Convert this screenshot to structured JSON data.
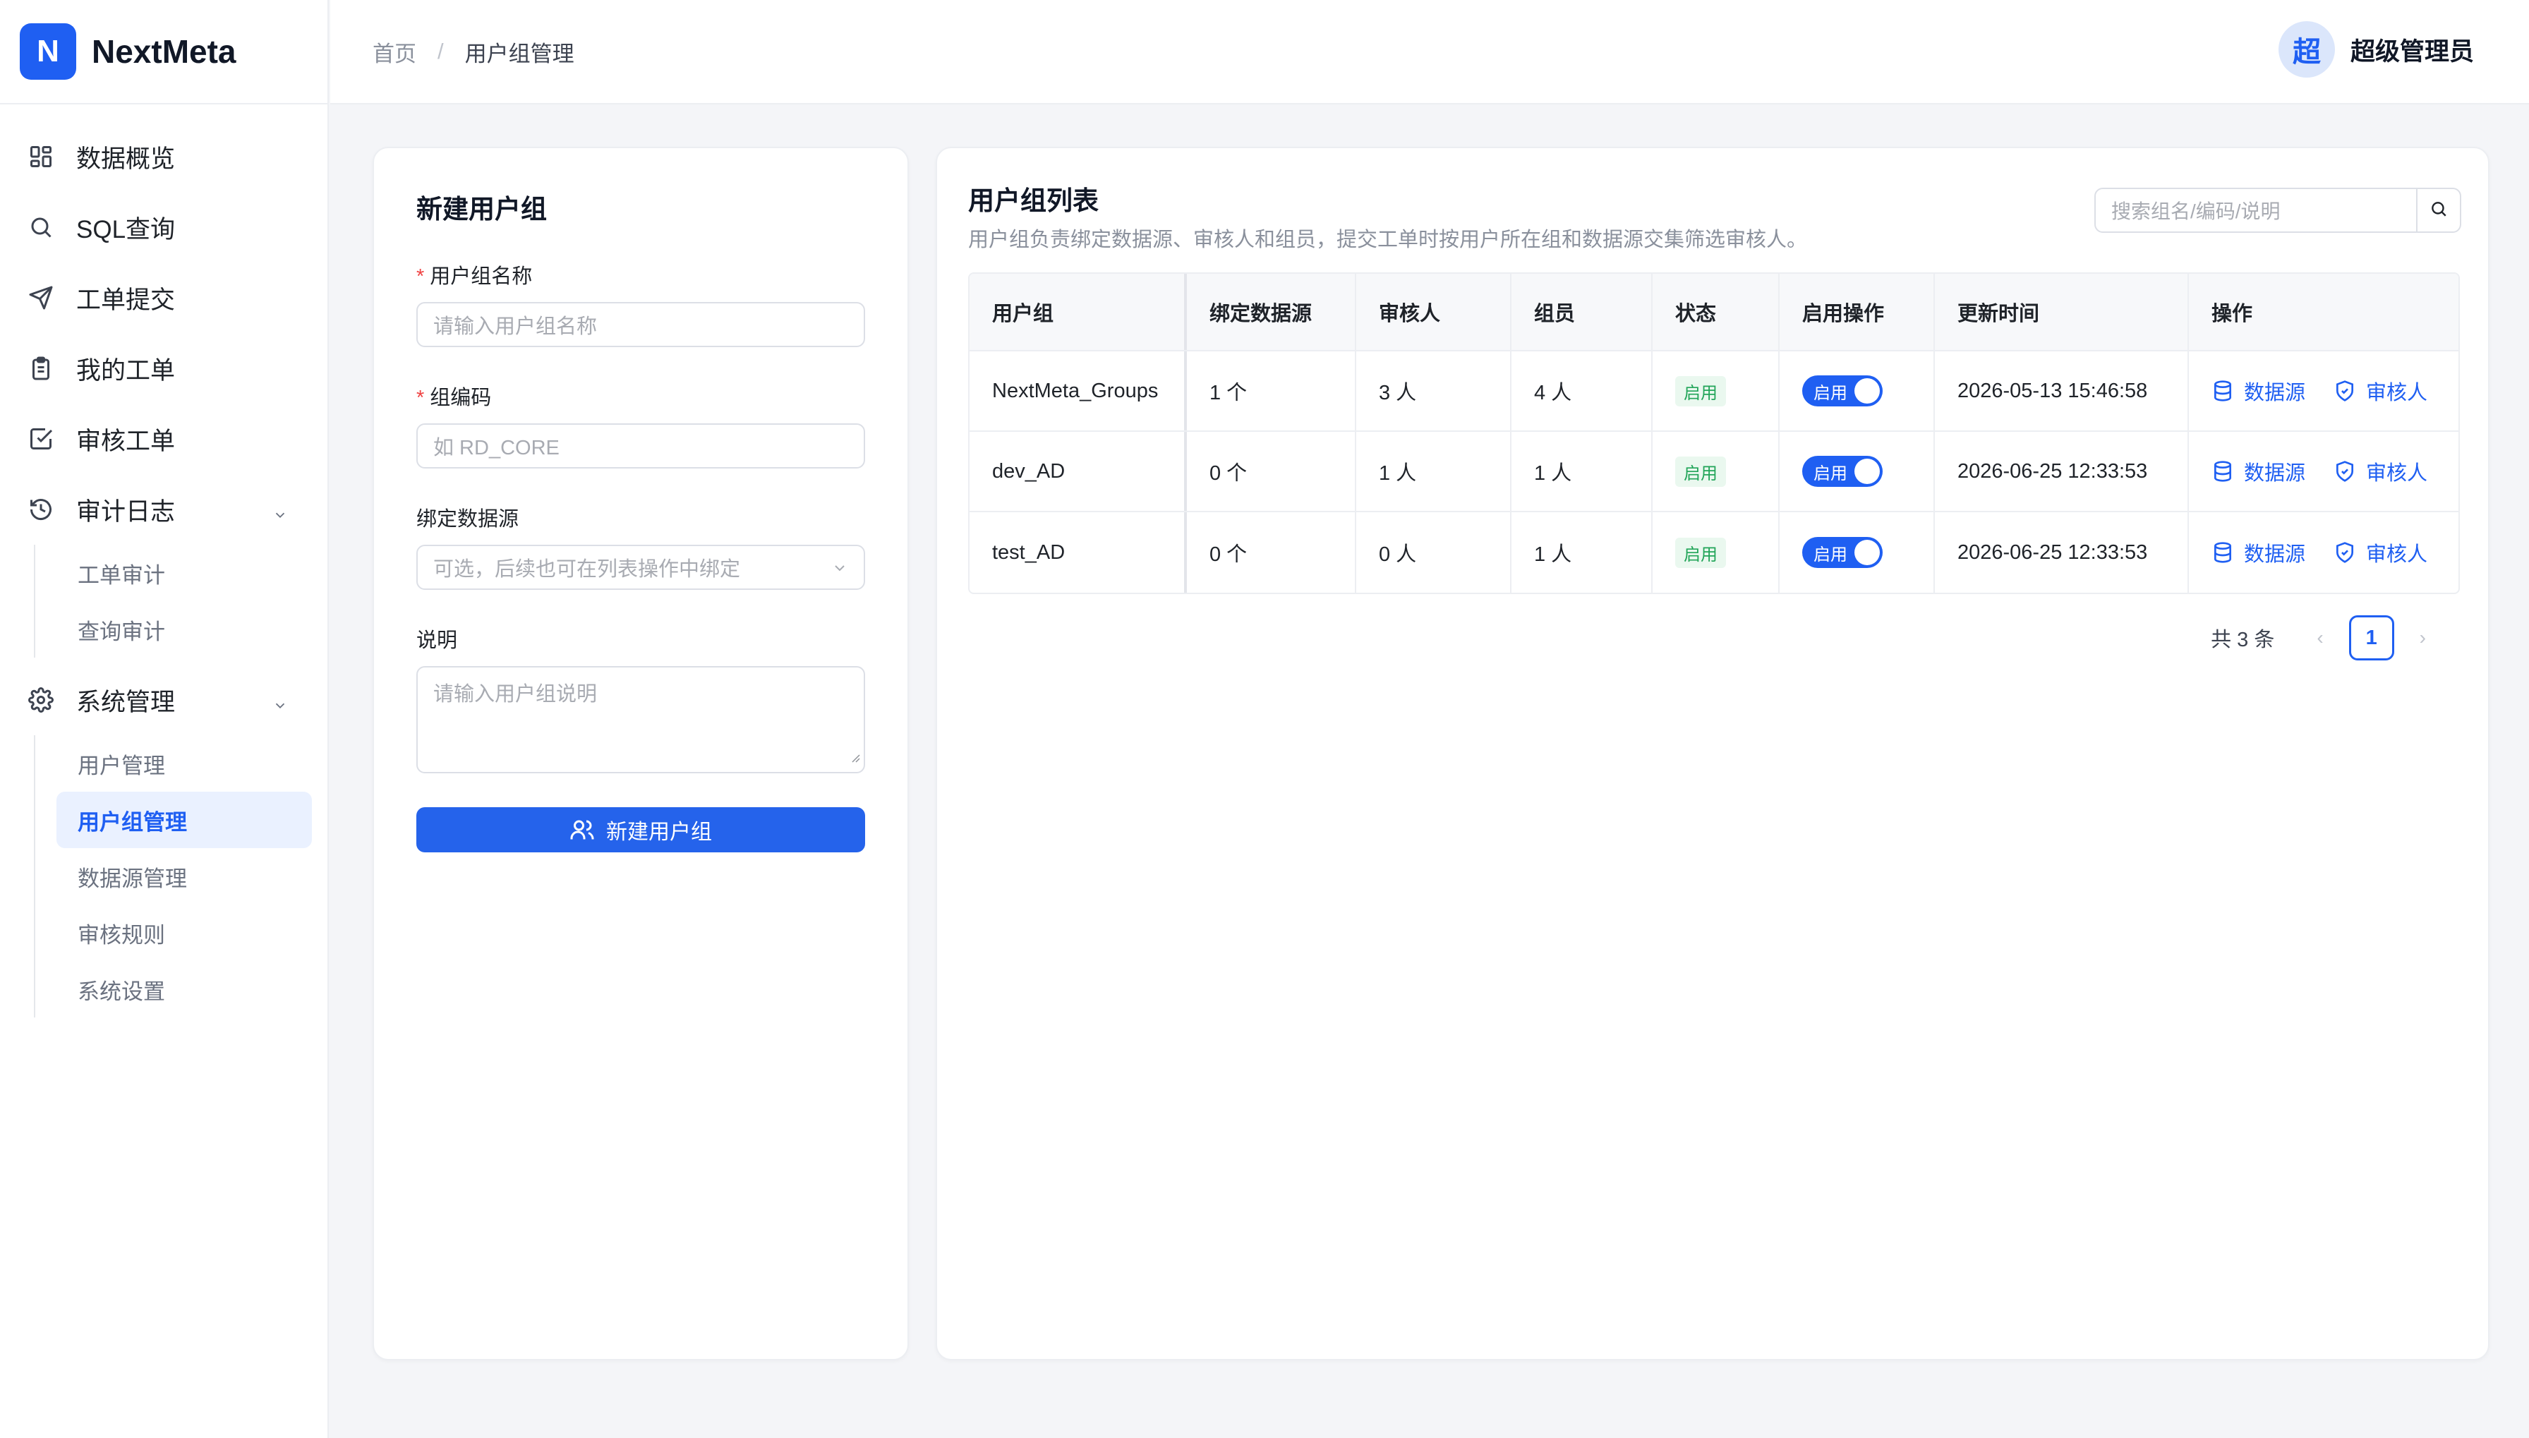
{
  "app": {
    "logo_letter": "N",
    "name": "NextMeta"
  },
  "colors": {
    "accent": "#1f5ff2",
    "success": "#22a559",
    "required": "#ef4444"
  },
  "sidebar": {
    "items": [
      {
        "label": "数据概览",
        "icon": "dashboard-icon"
      },
      {
        "label": "SQL查询",
        "icon": "search-icon"
      },
      {
        "label": "工单提交",
        "icon": "send-icon"
      },
      {
        "label": "我的工单",
        "icon": "clipboard-icon"
      },
      {
        "label": "审核工单",
        "icon": "check-square-icon"
      },
      {
        "label": "审计日志",
        "icon": "history-icon",
        "expanded": true
      },
      {
        "label": "系统管理",
        "icon": "gear-icon",
        "expanded": true
      }
    ],
    "audit_sub": [
      "工单审计",
      "查询审计"
    ],
    "system_sub": [
      "用户管理",
      "用户组管理",
      "数据源管理",
      "审核规则",
      "系统设置"
    ]
  },
  "header": {
    "breadcrumb": [
      "首页",
      "/",
      "用户组管理"
    ],
    "user_avatar": "超",
    "user_name": "超级管理员"
  },
  "form": {
    "title": "新建用户组",
    "name_label": "用户组名称",
    "name_placeholder": "请输入用户组名称",
    "code_label": "组编码",
    "code_placeholder": "如 RD_CORE",
    "datasource_label": "绑定数据源",
    "datasource_placeholder": "可选，后续也可在列表操作中绑定",
    "desc_label": "说明",
    "desc_placeholder": "请输入用户组说明",
    "submit_label": "新建用户组",
    "required_mark": "*"
  },
  "list": {
    "title": "用户组列表",
    "description": "用户组负责绑定数据源、审核人和组员，提交工单时按用户所在组和数据源交集筛选审核人。",
    "search_placeholder": "搜索组名/编码/说明",
    "columns": [
      "用户组",
      "绑定数据源",
      "审核人",
      "组员",
      "状态",
      "启用操作",
      "更新时间",
      "操作"
    ],
    "rows": [
      {
        "name": "NextMeta_Groups",
        "datasources": "1 个",
        "reviewers": "3 人",
        "members": "4 人",
        "status": "启用",
        "switch_label": "启用",
        "switch_on": true,
        "updated": "2026-05-13 15:46:58",
        "op_ds": "数据源",
        "op_rev": "审核人"
      },
      {
        "name": "dev_AD",
        "datasources": "0 个",
        "reviewers": "1 人",
        "members": "1 人",
        "status": "启用",
        "switch_label": "启用",
        "switch_on": true,
        "updated": "2026-06-25 12:33:53",
        "op_ds": "数据源",
        "op_rev": "审核人"
      },
      {
        "name": "test_AD",
        "datasources": "0 个",
        "reviewers": "0 人",
        "members": "1 人",
        "status": "启用",
        "switch_label": "启用",
        "switch_on": true,
        "updated": "2026-06-25 12:33:53",
        "op_ds": "数据源",
        "op_rev": "审核人"
      }
    ],
    "pager": {
      "total": "共 3 条",
      "prev": "‹",
      "current": "1",
      "next": "›"
    }
  }
}
